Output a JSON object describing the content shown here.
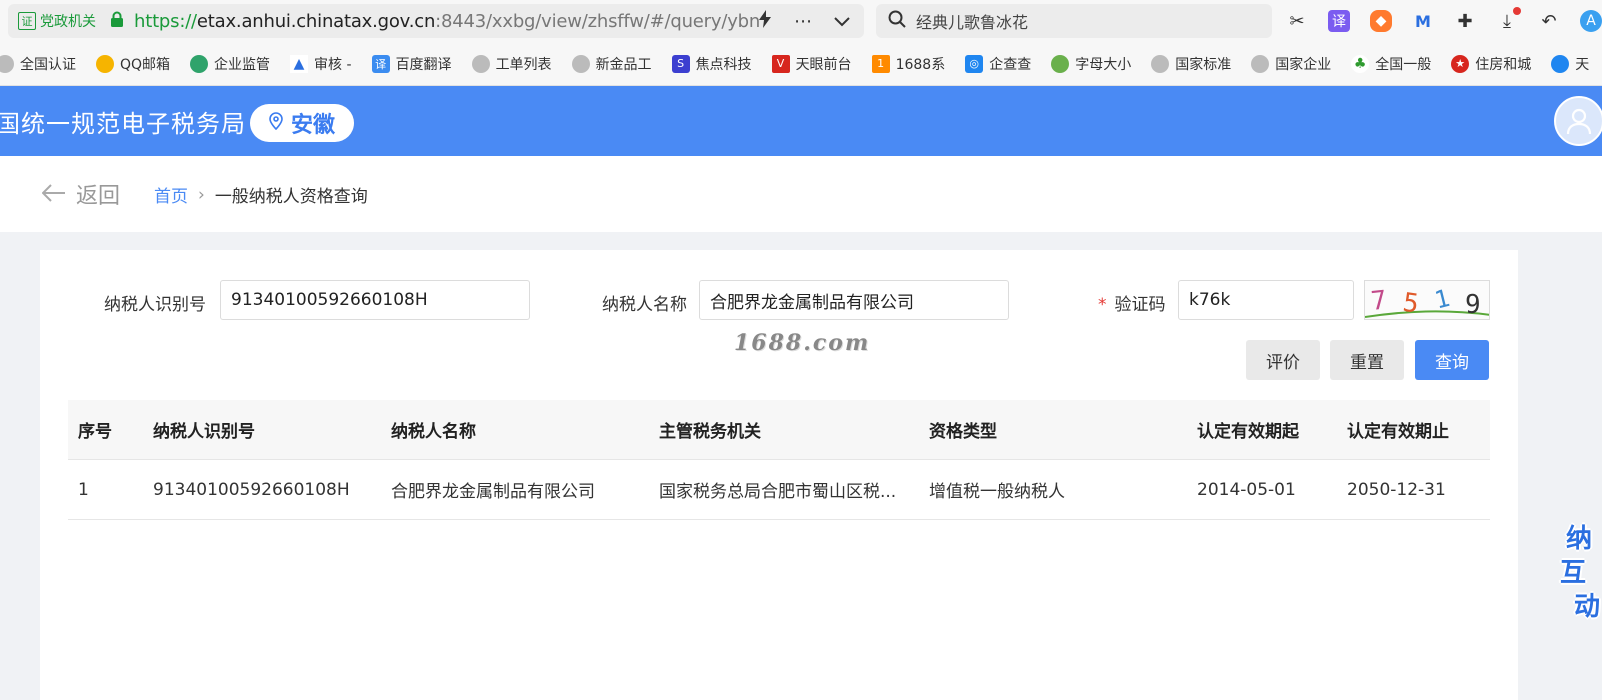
{
  "browser": {
    "site_badge": "党政机关",
    "url_scheme": "https://",
    "url_host": "etax.anhui.chinatax.gov.cn",
    "url_path": ":8443/xxbg/view/zhsffw/#/query/ybn",
    "search_text": "经典儿歌鲁冰花",
    "bookmarks": [
      "全国认证",
      "QQ邮箱",
      "企业监管",
      "审核 -",
      "百度翻译",
      "工单列表",
      "新金品工",
      "焦点科技",
      "天眼前台",
      "1688系",
      "企查查",
      "字母大小",
      "国家标准",
      "国家企业",
      "全国一般",
      "住房和城",
      "天"
    ]
  },
  "header": {
    "site_title": "国统一规范电子税务局",
    "region": "安徽"
  },
  "breadcrumb": {
    "back_label": "返回",
    "home": "首页",
    "current": "一般纳税人资格查询"
  },
  "form": {
    "taxpayer_id_label": "纳税人识别号",
    "taxpayer_id_value": "91340100592660108H",
    "taxpayer_name_label": "纳税人名称",
    "taxpayer_name_value": "合肥界龙金属制品有限公司",
    "captcha_label": "验证码",
    "captcha_required_mark": "*",
    "captcha_value": "k76k",
    "captcha_image_text": "7519",
    "buttons": {
      "evaluate": "评价",
      "reset": "重置",
      "query": "查询"
    }
  },
  "watermark": "1688.com",
  "table": {
    "headers": [
      "序号",
      "纳税人识别号",
      "纳税人名称",
      "主管税务机关",
      "资格类型",
      "认定有效期起",
      "认定有效期止"
    ],
    "rows": [
      [
        "1",
        "91340100592660108H",
        "合肥界龙金属制品有限公司",
        "国家税务总局合肥市蜀山区税...",
        "增值税一般纳税人",
        "2014-05-01",
        "2050-12-31"
      ]
    ]
  },
  "side_widget": [
    "纳",
    "互",
    "动"
  ],
  "colors": {
    "primary": "#4a8af4",
    "required": "#e53935",
    "secure_green": "#1a9a3a"
  }
}
